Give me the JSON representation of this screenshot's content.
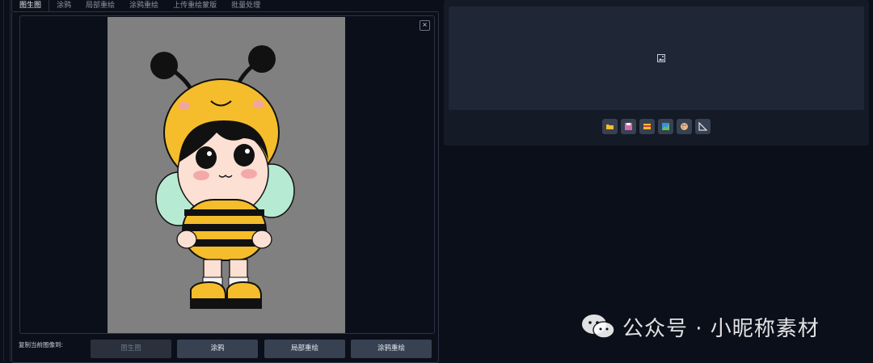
{
  "tabs": [
    {
      "label": "图生图",
      "active": true
    },
    {
      "label": "涂鸦",
      "active": false
    },
    {
      "label": "局部重绘",
      "active": false
    },
    {
      "label": "涂鸦重绘",
      "active": false
    },
    {
      "label": "上传重绘蒙版",
      "active": false
    },
    {
      "label": "批量处理",
      "active": false
    }
  ],
  "editor": {
    "close_symbol": "×",
    "canvas_color": "#808080",
    "character": "bee-costume-child-illustration"
  },
  "copy_label": "复制当前图像到:",
  "send_buttons": [
    {
      "label": "图生图",
      "disabled": true
    },
    {
      "label": "涂鸦",
      "disabled": false
    },
    {
      "label": "局部重绘",
      "disabled": false
    },
    {
      "label": "涂鸦重绘",
      "disabled": false
    }
  ],
  "output": {
    "placeholder_icon": "image-icon"
  },
  "toolbar": [
    {
      "icon": "folder-icon"
    },
    {
      "icon": "save-icon"
    },
    {
      "icon": "zip-icon"
    },
    {
      "icon": "send-to-img2img-icon"
    },
    {
      "icon": "palette-icon"
    },
    {
      "icon": "ruler-icon"
    }
  ],
  "watermark": {
    "text": "公众号 · 小昵称素材"
  },
  "colors": {
    "background": "#0b0f19",
    "panel": "#141a26",
    "button": "#374151",
    "border": "#2b3345"
  }
}
